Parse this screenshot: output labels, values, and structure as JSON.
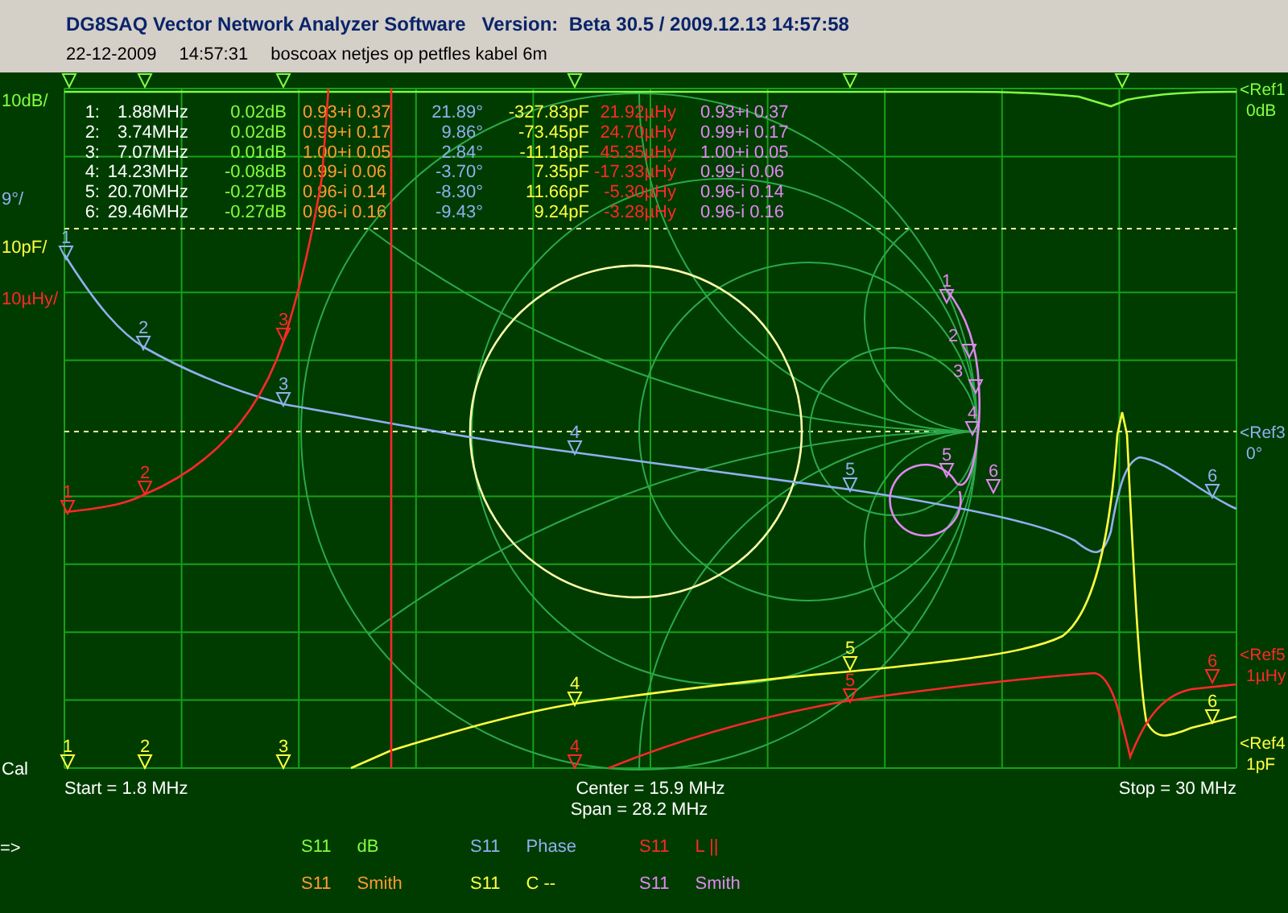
{
  "window": {
    "title": "DG8SAQ Vector Network Analyzer Software   Version:  Beta 30.5 / 2009.12.13 14:57:58"
  },
  "header": {
    "date": "22-12-2009",
    "time": "14:57:31",
    "comment": "boscoax netjes op petfles kabel 6m"
  },
  "traces": [
    {
      "parameter": "S11",
      "format": "dB",
      "color": "#80ff40",
      "scale": "10dB/"
    },
    {
      "parameter": "S11",
      "format": "Smith",
      "color": "#ff9a30"
    },
    {
      "parameter": "S11",
      "format": "Phase",
      "color": "#90b0f0",
      "scale": "9°/",
      "marker_labels": [
        "1",
        "2",
        "3",
        "4",
        "5",
        "6"
      ]
    },
    {
      "parameter": "S11",
      "format": "C --",
      "color": "#ffff40",
      "scale": "10pF/",
      "marker_labels": [
        "1",
        "2",
        "3",
        "4",
        "5",
        "6"
      ]
    },
    {
      "parameter": "S11",
      "format": "L ||",
      "color": "#ff2828",
      "scale": "10µHy/",
      "marker_labels": [
        "1",
        "2",
        "3",
        "4",
        "5",
        "6"
      ]
    },
    {
      "parameter": "S11",
      "format": "Smith",
      "color": "#e088f0",
      "marker_labels": [
        "1",
        "2",
        "3",
        "4",
        "5",
        "6"
      ]
    }
  ],
  "marker_table": {
    "rows": [
      {
        "index": "1:",
        "frequency": "1.88MHz",
        "values": [
          "0.02dB",
          "0.93+i 0.37",
          "21.89°",
          "-327.83pF",
          "21.92µHy",
          "0.93+i 0.37"
        ]
      },
      {
        "index": "2:",
        "frequency": "3.74MHz",
        "values": [
          "0.02dB",
          "0.99+i 0.17",
          "9.86°",
          "-73.45pF",
          "24.70µHy",
          "0.99+i 0.17"
        ]
      },
      {
        "index": "3:",
        "frequency": "7.07MHz",
        "values": [
          "0.01dB",
          "1.00+i 0.05",
          "2.84°",
          "-11.18pF",
          "45.35µHy",
          "1.00+i 0.05"
        ]
      },
      {
        "index": "4:",
        "frequency": "14.23MHz",
        "values": [
          "-0.08dB",
          "0.99-i 0.06",
          "-3.70°",
          "7.35pF",
          "-17.33µHy",
          "0.99-i 0.06"
        ]
      },
      {
        "index": "5:",
        "frequency": "20.70MHz",
        "values": [
          "-0.27dB",
          "0.96-i 0.14",
          "-8.30°",
          "11.66pF",
          "-5.30µHy",
          "0.96-i 0.14"
        ]
      },
      {
        "index": "6:",
        "frequency": "29.46MHz",
        "values": [
          "-0.27dB",
          "0.96-i 0.16",
          "-9.43°",
          "9.24pF",
          "-3.28µHy",
          "0.96-i 0.16"
        ]
      }
    ]
  },
  "references": [
    {
      "ref": "<Ref1",
      "value": "0dB",
      "color": "#80ff40"
    },
    {
      "ref": "<Ref3",
      "value": "0°",
      "color": "#90b0f0"
    },
    {
      "ref": "<Ref5",
      "value": "1µHy",
      "color": "#ff2828"
    },
    {
      "ref": "<Ref4",
      "value": "1pF",
      "color": "#ffff40"
    }
  ],
  "cal_label": "Cal",
  "sweep": {
    "start": "Start = 1.8 MHz",
    "center": "Center = 15.9 MHz",
    "stop": "Stop = 30 MHz",
    "span": "Span = 28.2 MHz"
  },
  "prompt": "=>"
}
